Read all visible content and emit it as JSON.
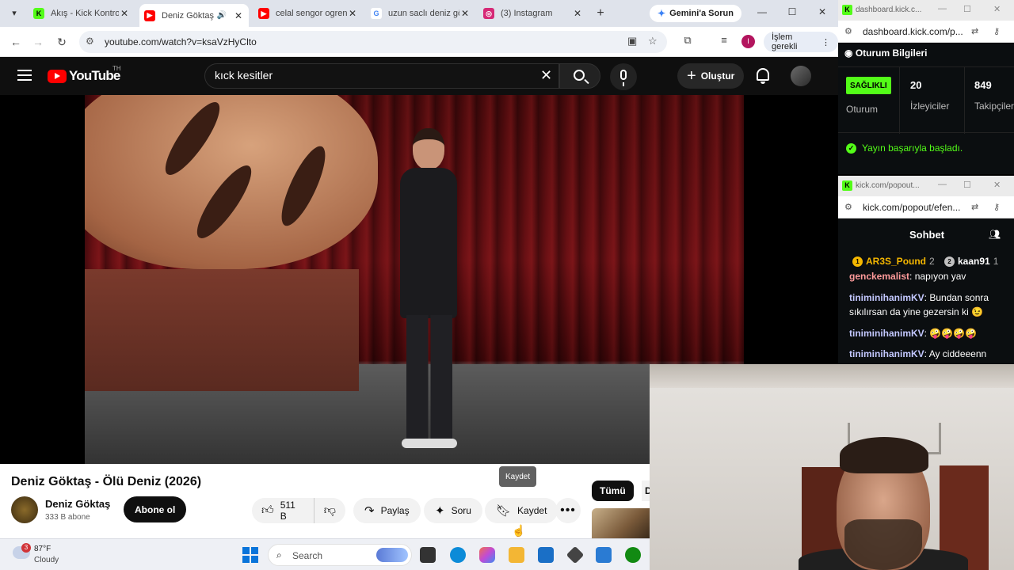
{
  "browser": {
    "tabs": [
      {
        "title": "Akış - Kick Kontrol",
        "icon": "kick-icon",
        "color": "#53fc18"
      },
      {
        "title": "Deniz Göktaş",
        "icon": "youtube-icon",
        "color": "#ff0000",
        "active": true
      },
      {
        "title": "celal sengor ogren",
        "icon": "youtube-icon",
        "color": "#ff0000"
      },
      {
        "title": "uzun saclı deniz gö",
        "icon": "google-icon",
        "color": "#4285f4"
      },
      {
        "title": "(3) Instagram",
        "icon": "instagram-icon",
        "color": "#d62976"
      }
    ],
    "gemini_label": "Gemini'a Sorun",
    "url": "youtube.com/watch?v=ksaVzHyClto",
    "profile_initial": "I",
    "islem_label": "İşlem gerekli"
  },
  "youtube": {
    "logo_text": "YouTube",
    "country": "TH",
    "search_value": "kıck kesitler",
    "create_label": "Oluştur",
    "video_title": "Deniz Göktaş - Ölü Deniz (2026)",
    "channel_name": "Deniz Göktaş",
    "subscribers": "333 B abone",
    "subscribe_label": "Abone ol",
    "likes": "511 B",
    "share_label": "Paylaş",
    "ask_label": "Soru",
    "save_label": "Kaydet",
    "tooltip": "Kaydet",
    "chip_all": "Tümü",
    "chip_next": "D"
  },
  "kick_dashboard": {
    "window_title": "dashboard.kick.c...",
    "url": "dashboard.kick.com/p...",
    "section_title": "Oturum Bilgileri",
    "health_badge": "SAĞLIKLI",
    "session_label": "Oturum",
    "viewers_value": "20",
    "viewers_label": "İzleyiciler",
    "followers_value": "849",
    "followers_label": "Takipçiler",
    "status_message": "Yayın başarıyla başladı."
  },
  "kick_chat": {
    "window_title": "kick.com/popout...",
    "url": "kick.com/popout/efen...",
    "title": "Sohbet",
    "leaders": [
      {
        "rank": "1",
        "name": "AR3S_Pound",
        "count": "2",
        "badge_color": "#f5b700"
      },
      {
        "rank": "2",
        "name": "kaan91",
        "count": "1",
        "badge_color": "#c0c0c0"
      }
    ],
    "messages": [
      {
        "user": "genckemalist",
        "text": "napıyon yav",
        "color": "#ff9b9b"
      },
      {
        "user": "tiniminihanimKV",
        "text": "Bundan sonra sıkılırsan da yine gezersin ki 😉",
        "color": "#c3c8ff"
      },
      {
        "user": "tiniminihanimKV",
        "text": "🤪🤪🤪🤪",
        "color": "#c3c8ff"
      },
      {
        "user": "tiniminihanimKV",
        "text": "Ay ciddeeenn",
        "color": "#c3c8ff"
      }
    ]
  },
  "taskbar": {
    "weather_badge": "3",
    "temperature": "87°F",
    "condition": "Cloudy",
    "search_label": "Search",
    "apps": [
      {
        "icon": "task-view-icon",
        "color": "#333333"
      },
      {
        "icon": "edge-icon",
        "color": "#0c8bd8"
      },
      {
        "icon": "copilot-icon",
        "color": "#c04bd6"
      },
      {
        "icon": "file-explorer-icon",
        "color": "#f3b634"
      },
      {
        "icon": "store-icon",
        "color": "#1a6fc6"
      },
      {
        "icon": "app-cube-icon",
        "color": "#444444"
      },
      {
        "icon": "vscode-icon",
        "color": "#2a7bd3"
      },
      {
        "icon": "xbox-icon",
        "color": "#128a12"
      }
    ]
  }
}
